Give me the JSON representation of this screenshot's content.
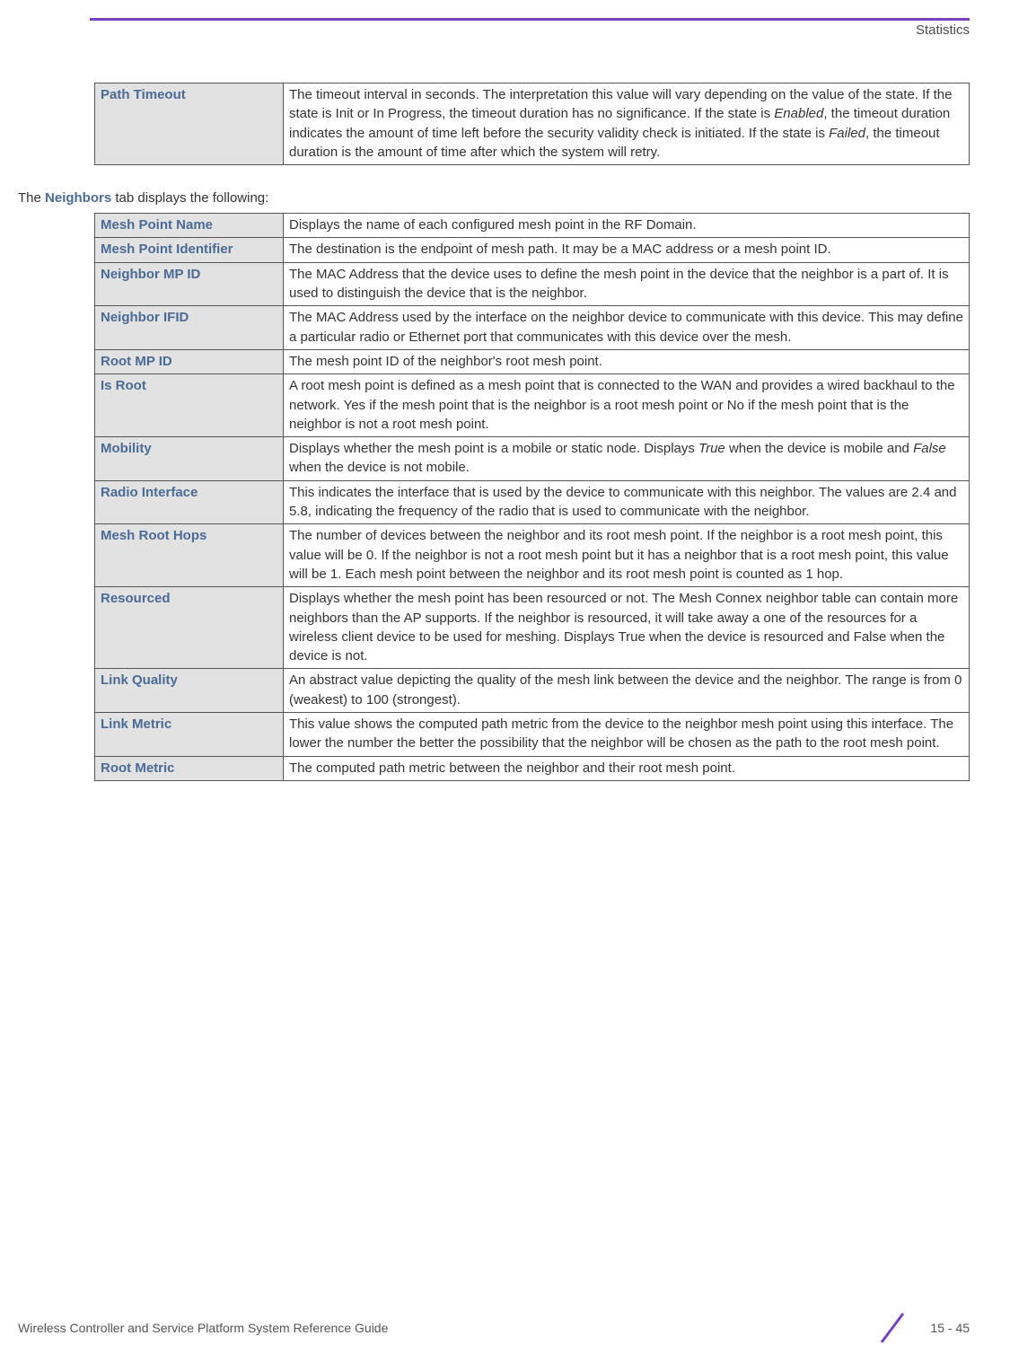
{
  "header": {
    "section_label": "Statistics"
  },
  "table1": {
    "rows": [
      {
        "label": "Path Timeout",
        "desc_parts": [
          {
            "t": "The timeout interval in seconds. The interpretation this value will vary depending on the value of the state. If the state is Init or In Progress, the timeout duration has no significance. If the state is "
          },
          {
            "t": "Enabled",
            "italic": true
          },
          {
            "t": ", the timeout duration indicates the amount of time left before the security validity check is initiated. If the state is "
          },
          {
            "t": "Failed",
            "italic": true
          },
          {
            "t": ", the timeout duration is the amount of time after which the system will retry."
          }
        ]
      }
    ]
  },
  "intro": {
    "prefix": "The ",
    "bold": "Neighbors",
    "suffix": " tab displays the following:"
  },
  "table2": {
    "rows": [
      {
        "label": "Mesh Point Name",
        "desc_parts": [
          {
            "t": "Displays the name of each configured mesh point in the RF Domain."
          }
        ]
      },
      {
        "label": "Mesh Point Identifier",
        "desc_parts": [
          {
            "t": "The destination is the endpoint of mesh path. It may be a MAC address or a mesh point ID."
          }
        ]
      },
      {
        "label": "Neighbor MP ID",
        "desc_parts": [
          {
            "t": "The MAC Address that the device uses to define the mesh point in the device that the neighbor is a part of. It is used to distinguish the device that is the neighbor."
          }
        ]
      },
      {
        "label": "Neighbor IFID",
        "desc_parts": [
          {
            "t": "The MAC Address used by the interface on the neighbor device to communicate with this device. This may define a particular radio or Ethernet port that communicates with this device over the mesh."
          }
        ]
      },
      {
        "label": "Root MP ID",
        "desc_parts": [
          {
            "t": "The mesh point ID of the neighbor's root mesh point."
          }
        ]
      },
      {
        "label": "Is Root",
        "desc_parts": [
          {
            "t": "A root mesh point is defined as a mesh point that is connected to the WAN and provides a wired backhaul to the network. Yes if the mesh point that is the neighbor is a root mesh point or No if the mesh point that is the neighbor is not a root mesh point."
          }
        ]
      },
      {
        "label": "Mobility",
        "desc_parts": [
          {
            "t": "Displays whether the mesh point is a mobile or static node. Displays "
          },
          {
            "t": "True",
            "italic": true
          },
          {
            "t": " when the device is mobile and "
          },
          {
            "t": "False",
            "italic": true
          },
          {
            "t": " when the device is not mobile."
          }
        ]
      },
      {
        "label": "Radio Interface",
        "desc_parts": [
          {
            "t": "This indicates the interface that is used by the device to communicate with this neighbor. The values are 2.4 and 5.8, indicating the frequency of the radio that is used to communicate with the neighbor."
          }
        ]
      },
      {
        "label": "Mesh Root Hops",
        "desc_parts": [
          {
            "t": "The number of devices between the neighbor and its root mesh point. If the neighbor is a root mesh point, this value will be 0. If the neighbor is not a root mesh point but it has a neighbor that is a root mesh point, this value will be 1. Each mesh point between the neighbor and its root mesh point is counted as 1 hop."
          }
        ]
      },
      {
        "label": "Resourced",
        "desc_parts": [
          {
            "t": "Displays whether the mesh point has been resourced or not. The Mesh Connex neighbor table can contain more neighbors than the AP supports. If the neighbor is resourced, it will take away a one of the resources for a wireless client device to be used for meshing. Displays True when the device is resourced and False when the device is not."
          }
        ]
      },
      {
        "label": "Link Quality",
        "desc_parts": [
          {
            "t": "An abstract value depicting the quality of the mesh link between the device and the neighbor. The range is from 0 (weakest) to 100 (strongest)."
          }
        ]
      },
      {
        "label": "Link Metric",
        "desc_parts": [
          {
            "t": "This value shows the computed path metric from the device to the neighbor mesh point using this interface. The lower the number the better the possibility that the neighbor will be chosen as the path to the root mesh point."
          }
        ]
      },
      {
        "label": "Root Metric",
        "desc_parts": [
          {
            "t": "The computed path metric between the neighbor and their root mesh point."
          }
        ]
      }
    ]
  },
  "footer": {
    "left": "Wireless Controller and Service Platform System Reference Guide",
    "page": "15 - 45"
  }
}
